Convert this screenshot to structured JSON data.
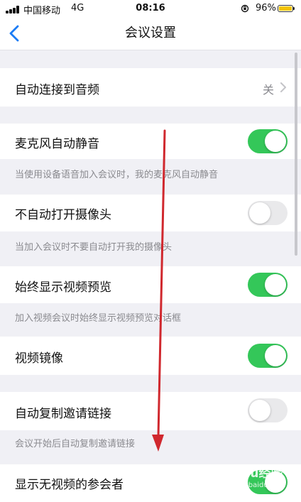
{
  "status_bar": {
    "carrier": "中国移动",
    "network": "4G",
    "time": "08:16",
    "battery_percent": "96%",
    "battery_color": "#f5c400"
  },
  "nav": {
    "title": "会议设置",
    "back_icon": "chevron-left-icon"
  },
  "settings": [
    {
      "label": "自动连接到音频",
      "control": "value",
      "value": "关"
    },
    {
      "label": "麦克风自动静音",
      "control": "toggle",
      "on": true,
      "description": "当使用设备语音加入会议时，我的麦克风自动静音"
    },
    {
      "label": "不自动打开摄像头",
      "control": "toggle",
      "on": false,
      "description": "当加入会议时不要自动打开我的摄像头"
    },
    {
      "label": "始终显示视频预览",
      "control": "toggle",
      "on": true,
      "description": "加入视频会议时始终显示视频预览对话框"
    },
    {
      "label": "视频镜像",
      "control": "toggle",
      "on": true
    },
    {
      "label": "自动复制邀请链接",
      "control": "toggle",
      "on": false,
      "description": "会议开始后自动复制邀请链接"
    },
    {
      "label": "显示无视频的参会者",
      "control": "toggle",
      "on": true
    }
  ],
  "colors": {
    "toggle_on": "#34c759",
    "toggle_off": "#e9e9eb",
    "accent": "#1a7cf5",
    "annotation_arrow": "#d0282e"
  },
  "watermark": {
    "brand": "Baidu经验",
    "url": "jingyan.baidu.com"
  }
}
